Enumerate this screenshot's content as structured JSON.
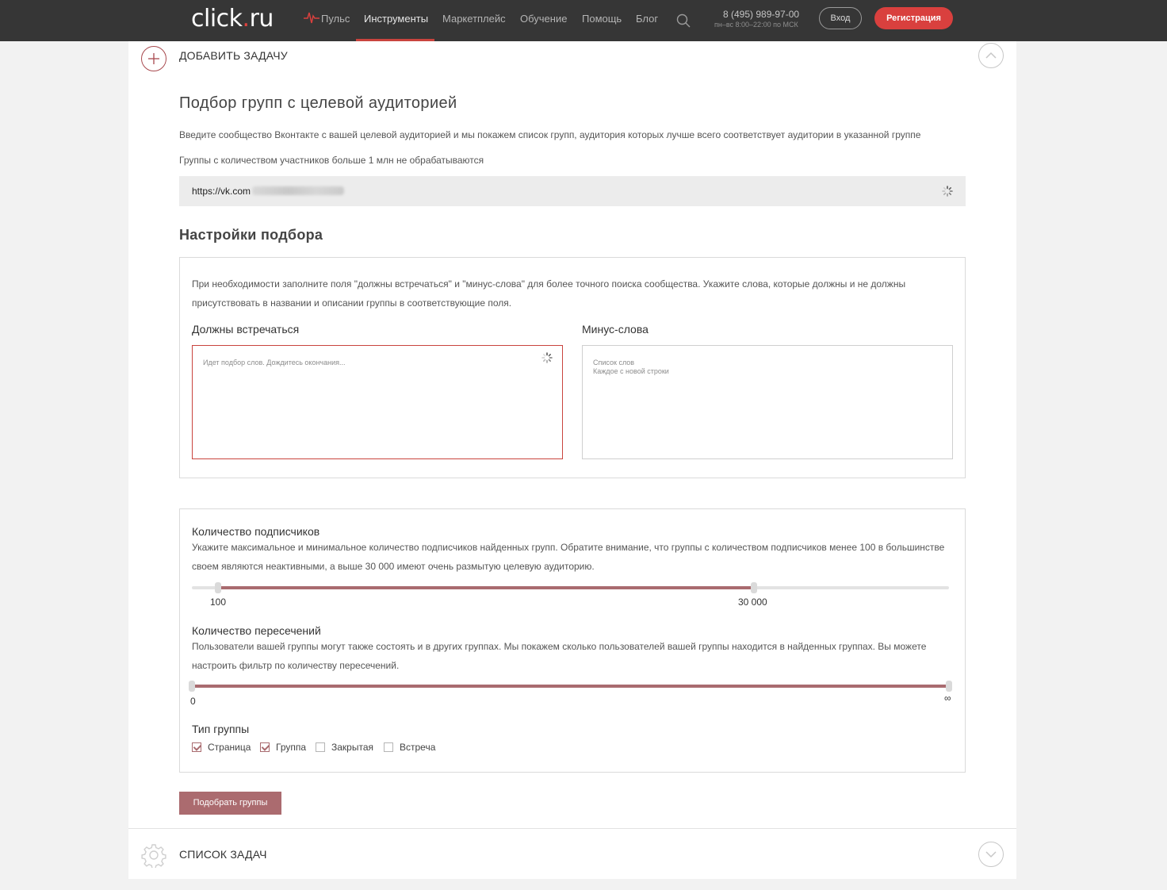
{
  "header": {
    "logo_main": "click",
    "logo_dot": ".",
    "logo_tld": "ru",
    "nav": [
      "Пульс",
      "Инструменты",
      "Маркетплейс",
      "Обучение",
      "Помощь",
      "Блог"
    ],
    "phone": "8 (495) 989-97-00",
    "hours": "пн–вс 8:00–22:00 по МСК",
    "login": "Вход",
    "register": "Регистрация"
  },
  "add_task": {
    "title": "ДОБАВИТЬ ЗАДАЧУ"
  },
  "main": {
    "title": "Подбор групп с целевой аудиторией",
    "description": "Введите сообщество Вконтакте с вашей целевой аудиторией и мы покажем список групп, аудитория которых лучше всего соответствует аудитории в указанной группе",
    "note": "Группы с количеством участников больше 1 млн не обрабатываются",
    "url_value": "https://vk.com"
  },
  "settings": {
    "title": "Настройки подбора",
    "help_text": "При необходимости заполните поля \"должны встречаться\" и \"минус-слова\" для более точного поиска сообщества. Укажите слова, которые должны и не должны присутствовать в названии и описании группы в соответствующие поля.",
    "must_label": "Должны встречаться",
    "must_placeholder": "Идет подбор слов. Дождитесь окончания...",
    "minus_label": "Минус-слова",
    "minus_placeholder": "Список слов\nКаждое с новой строки"
  },
  "filters": {
    "subscribers": {
      "label": "Количество подписчиков",
      "text": "Укажите максимальное и минимальное количество подписчиков найденных групп. Обратите внимание, что группы с количеством подписчиков менее 100 в большинстве своем являются неактивными, а выше 30 000 имеют очень размытую целевую аудиторию.",
      "min_label": "100",
      "max_label": "30 000",
      "min_fraction": 0.035,
      "max_fraction": 0.742
    },
    "intersections": {
      "label": "Количество пересечений",
      "text": "Пользователи вашей группы могут также состоять и в других группах. Мы покажем сколько пользователей вашей группы находится в найденных группах. Вы можете настроить фильтр по количеству пересечений.",
      "min_label": "0",
      "max_label": "∞",
      "min_fraction": 0.0,
      "max_fraction": 1.0
    },
    "group_type": {
      "label": "Тип группы",
      "options": [
        {
          "label": "Страница",
          "checked": true
        },
        {
          "label": "Группа",
          "checked": true
        },
        {
          "label": "Закрытая",
          "checked": false
        },
        {
          "label": "Встреча",
          "checked": false
        }
      ]
    }
  },
  "submit_label": "Подобрать группы",
  "task_list": {
    "title": "СПИСОК ЗАДАЧ"
  },
  "colors": {
    "accent": "#a96b6f",
    "brand_red": "#d9403e",
    "nav_bg": "#363636"
  }
}
